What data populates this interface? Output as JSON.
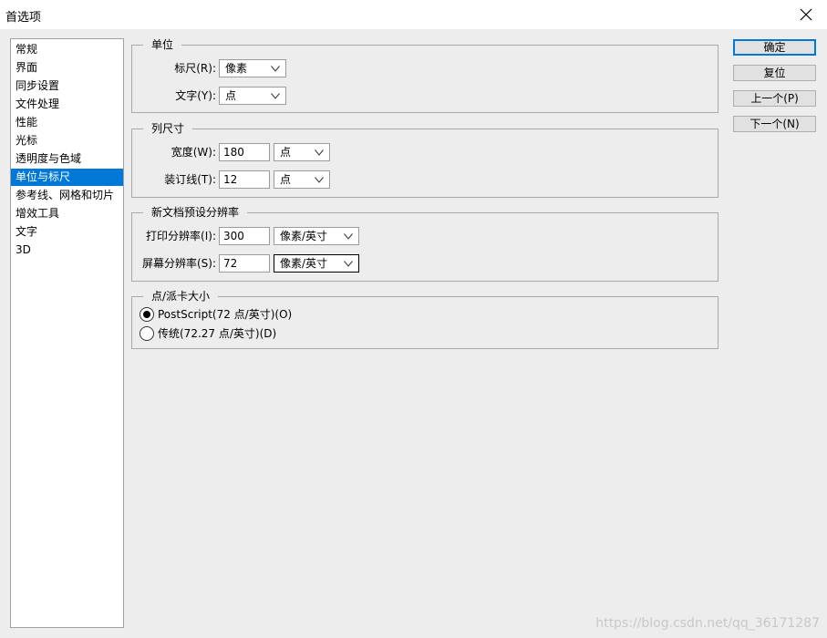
{
  "window": {
    "title": "首选项",
    "close_icon": "close-icon"
  },
  "nav": {
    "items": [
      "常规",
      "界面",
      "同步设置",
      "文件处理",
      "性能",
      "光标",
      "透明度与色域",
      "单位与标尺",
      "参考线、网格和切片",
      "增效工具",
      "文字",
      "3D"
    ],
    "selected": "单位与标尺",
    "selected_color": "#0078d7"
  },
  "units": {
    "title": "单位",
    "ruler_label": "标尺(R):",
    "ruler_value": "像素",
    "type_label": "文字(Y):",
    "type_value": "点"
  },
  "column_size": {
    "title": "列尺寸",
    "width_label": "宽度(W):",
    "width_value": "180",
    "width_unit": "点",
    "gutter_label": "装订线(T):",
    "gutter_value": "12",
    "gutter_unit": "点"
  },
  "new_doc_resolution": {
    "title": "新文档预设分辨率",
    "print_label": "打印分辨率(I):",
    "print_value": "300",
    "print_unit": "像素/英寸",
    "screen_label": "屏幕分辨率(S):",
    "screen_value": "72",
    "screen_unit": "像素/英寸"
  },
  "point_size": {
    "title": "点/派卡大小",
    "option_postscript": "PostScript(72 点/英寸)(O)",
    "option_traditional": "传统(72.27 点/英寸)(D)",
    "selected": "PostScript(72 点/英寸)(O)"
  },
  "buttons": {
    "ok": "确定",
    "reset": "复位",
    "prev": "上一个(P)",
    "next": "下一个(N)"
  },
  "watermark": "https://blog.csdn.net/qq_36171287"
}
